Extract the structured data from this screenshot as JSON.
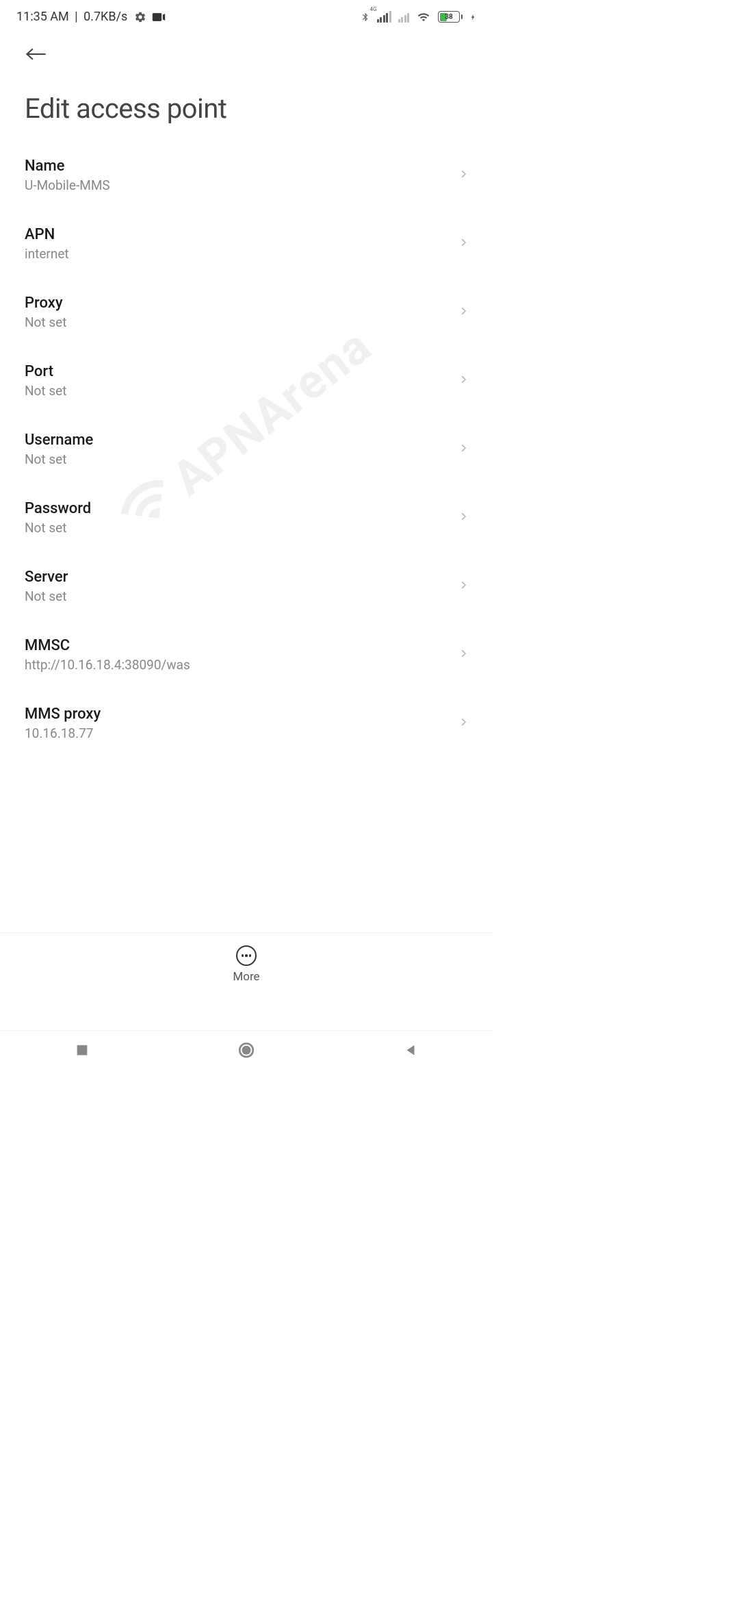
{
  "status_bar": {
    "time": "11:35 AM",
    "speed": "0.7KB/s",
    "battery_percent": "38"
  },
  "header": {
    "title": "Edit access point"
  },
  "settings": {
    "items": [
      {
        "label": "Name",
        "value": "U-Mobile-MMS"
      },
      {
        "label": "APN",
        "value": "internet"
      },
      {
        "label": "Proxy",
        "value": "Not set"
      },
      {
        "label": "Port",
        "value": "Not set"
      },
      {
        "label": "Username",
        "value": "Not set"
      },
      {
        "label": "Password",
        "value": "Not set"
      },
      {
        "label": "Server",
        "value": "Not set"
      },
      {
        "label": "MMSC",
        "value": "http://10.16.18.4:38090/was"
      },
      {
        "label": "MMS proxy",
        "value": "10.16.18.77"
      }
    ]
  },
  "bottom": {
    "more_label": "More"
  },
  "watermark": {
    "text": "APNArena"
  }
}
